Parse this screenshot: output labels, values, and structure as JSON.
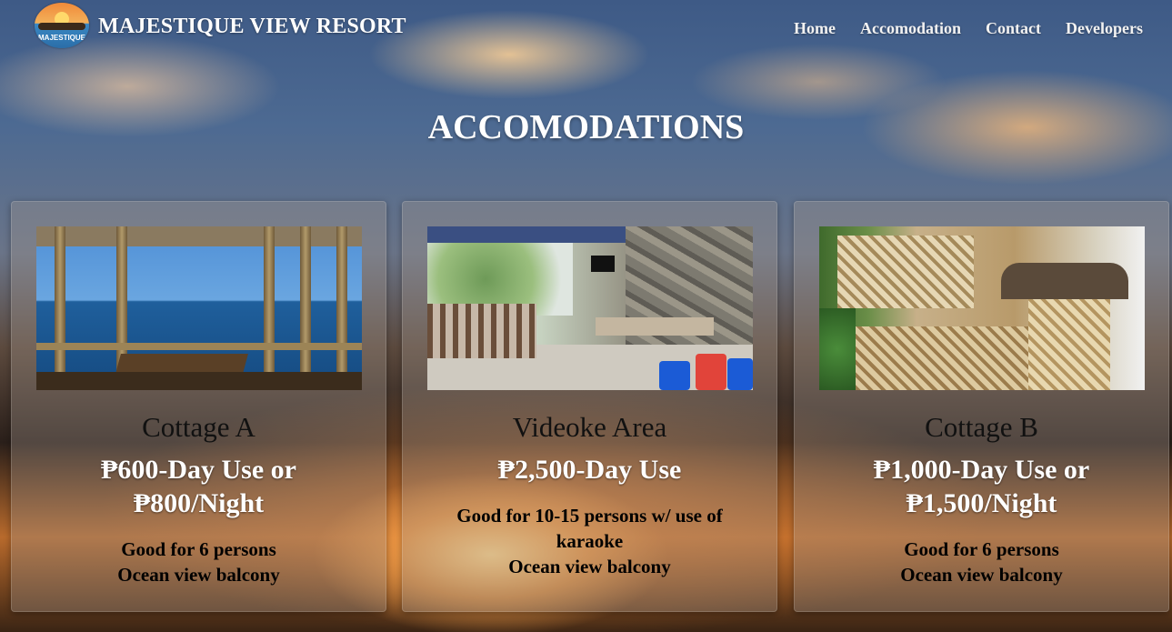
{
  "brand": {
    "name": "MAJESTIQUE VIEW RESORT",
    "logo_text": "MAJESTIQUE"
  },
  "nav": {
    "items": [
      "Home",
      "Accomodation",
      "Contact",
      "Developers"
    ]
  },
  "page": {
    "title": "ACCOMODATIONS"
  },
  "cards": [
    {
      "title": "Cottage A",
      "price": "₱600-Day Use or ₱800/Night",
      "desc": [
        "Good for 6 persons",
        "Ocean view balcony"
      ],
      "image": "bamboo-balcony-ocean-photo"
    },
    {
      "title": "Videoke Area",
      "price": "₱2,500-Day Use",
      "desc": [
        "Good for 10-15 persons w/ use of karaoke",
        "Ocean view balcony"
      ],
      "image": "videoke-patio-photo"
    },
    {
      "title": "Cottage B",
      "price": "₱1,000-Day Use or ₱1,500/Night",
      "desc": [
        "Good for 6 persons",
        "Ocean view balcony"
      ],
      "image": "bamboo-cottage-photo"
    }
  ],
  "colors": {
    "title_text": "#ffffff",
    "card_title": "#111111",
    "price_text": "#ffffff",
    "desc_text": "#000000"
  }
}
